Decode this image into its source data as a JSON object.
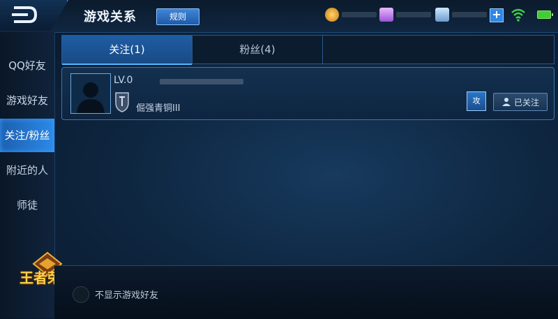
{
  "header": {
    "title": "游戏关系",
    "rules_label": "规则"
  },
  "sidebar": {
    "items": [
      {
        "label": "QQ好友"
      },
      {
        "label": "游戏好友"
      },
      {
        "label": "关注/粉丝"
      },
      {
        "label": "附近的人"
      },
      {
        "label": "师徒"
      }
    ],
    "logo_text": "王者荣耀"
  },
  "tabs": [
    {
      "label": "关注(1)"
    },
    {
      "label": "粉丝(4)"
    }
  ],
  "friend_row": {
    "level": "LV.0",
    "rank": "倔强青铜III",
    "followed_label": "已关注",
    "follow_icon_label": "攻"
  },
  "bottom": {
    "hide_friends_label": "不显示游戏好友"
  },
  "colors": {
    "accent": "#2c8ae8",
    "background": "#0e2640",
    "battery": "#3fcf35",
    "wifi": "#40d24a"
  }
}
